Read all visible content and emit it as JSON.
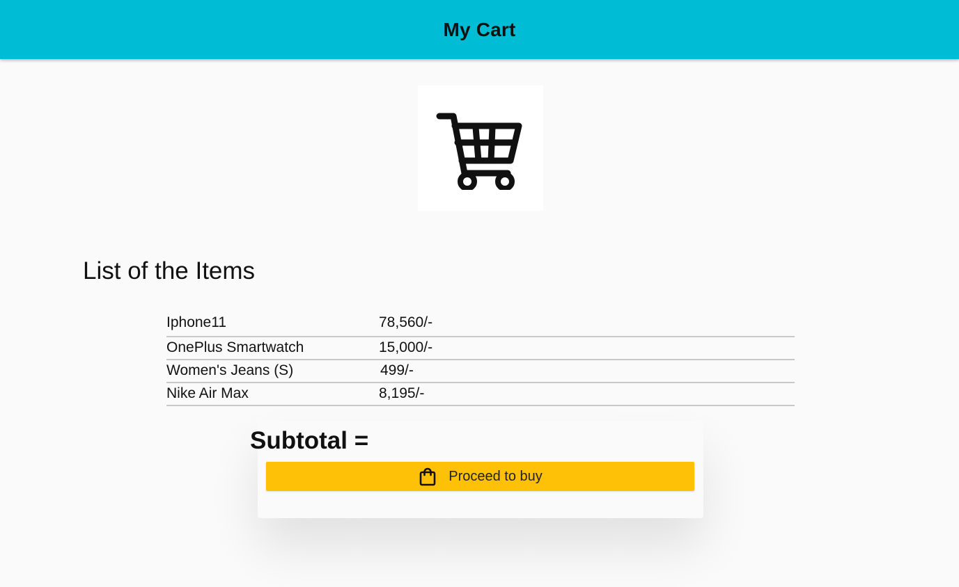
{
  "appbar": {
    "title": "My Cart",
    "color": "#00bcd4"
  },
  "cart_image": {
    "icon": "shopping-cart-icon"
  },
  "items_section": {
    "heading": "List of the Items",
    "items": [
      {
        "name": "Iphone11",
        "price": "78,560/-"
      },
      {
        "name": "OnePlus Smartwatch",
        "price": "15,000/-"
      },
      {
        "name": "Women's Jeans (S)",
        "price": "499/-"
      },
      {
        "name": "Nike Air Max",
        "price": "8,195/-"
      }
    ]
  },
  "subtotal": {
    "label": "Subtotal ="
  },
  "buy_button": {
    "label": "Proceed to buy",
    "icon": "shopping-bag-icon",
    "color": "#ffc107"
  }
}
